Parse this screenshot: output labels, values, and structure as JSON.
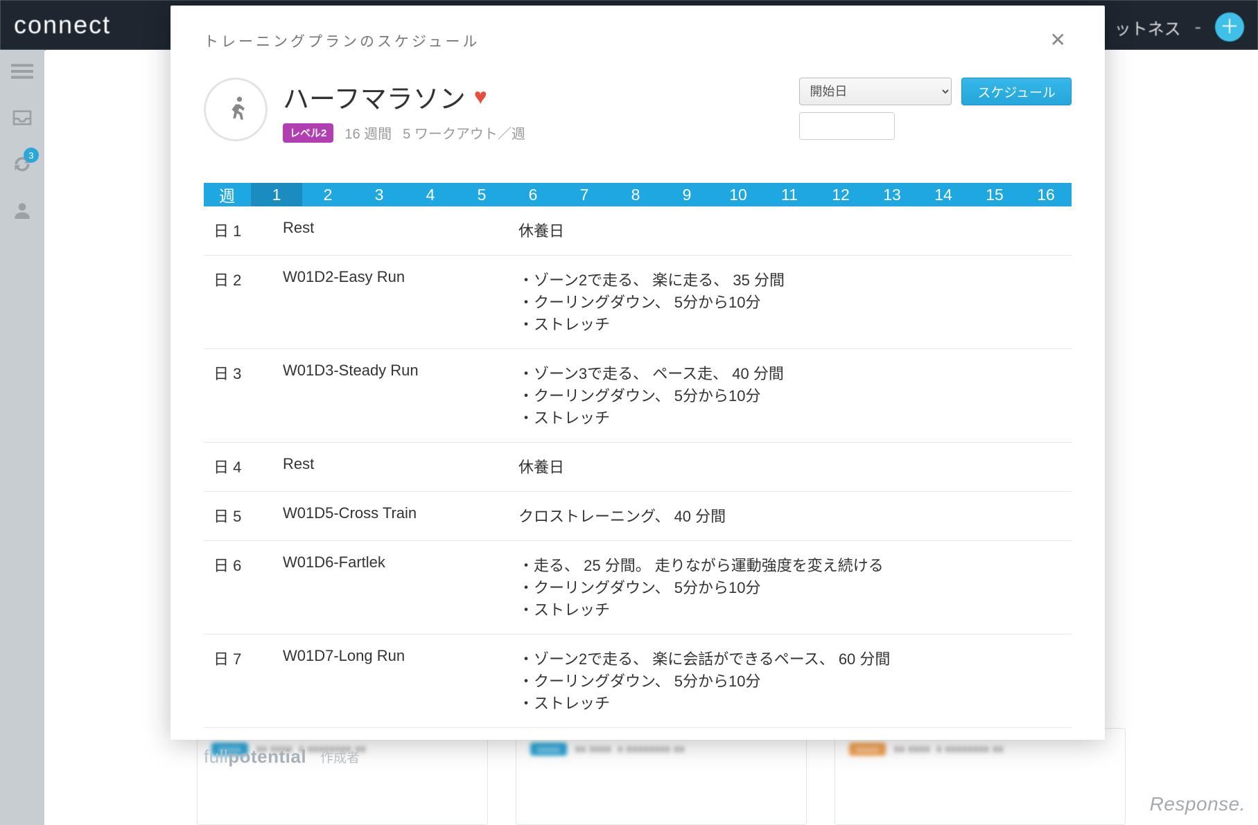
{
  "topbar": {
    "logo": "connect",
    "right_label": "ットネス",
    "dash": "-"
  },
  "sidebar": {
    "badge": "3"
  },
  "modal": {
    "title": "トレーニングプランのスケジュール",
    "plan_title": "ハーフマラソン",
    "level_badge": "レベル2",
    "duration": "16 週間",
    "workouts_per_week": "5 ワークアウト／週",
    "start_select": "開始日",
    "schedule_button": "スケジュール",
    "week_label": "週",
    "weeks": [
      "1",
      "2",
      "3",
      "4",
      "5",
      "6",
      "7",
      "8",
      "9",
      "10",
      "11",
      "12",
      "13",
      "14",
      "15",
      "16"
    ],
    "active_week_index": 0,
    "days": [
      {
        "num": "日 1",
        "name": "Rest",
        "desc": [
          "休養日"
        ]
      },
      {
        "num": "日 2",
        "name": "W01D2-Easy Run",
        "desc": [
          "・ゾーン2で走る、 楽に走る、 35 分間",
          "・クーリングダウン、 5分から10分",
          "・ストレッチ"
        ]
      },
      {
        "num": "日 3",
        "name": "W01D3-Steady Run",
        "desc": [
          "・ゾーン3で走る、 ペース走、 40 分間",
          "・クーリングダウン、 5分から10分",
          "・ストレッチ"
        ]
      },
      {
        "num": "日 4",
        "name": "Rest",
        "desc": [
          "休養日"
        ]
      },
      {
        "num": "日 5",
        "name": "W01D5-Cross Train",
        "desc": [
          "クロストレーニング、 40 分間"
        ]
      },
      {
        "num": "日 6",
        "name": "W01D6-Fartlek",
        "desc": [
          "・走る、 25 分間。 走りながら運動強度を変え続ける",
          "・クーリングダウン、 5分から10分",
          "・ストレッチ"
        ]
      },
      {
        "num": "日 7",
        "name": "W01D7-Long Run",
        "desc": [
          "・ゾーン2で走る、 楽に会話ができるペース、 60 分間",
          "・クーリングダウン、 5分から10分",
          "・ストレッチ"
        ]
      }
    ],
    "footer_brand_1": "full",
    "footer_brand_2": "potential",
    "author_label": "作成者"
  },
  "watermark": "Response."
}
